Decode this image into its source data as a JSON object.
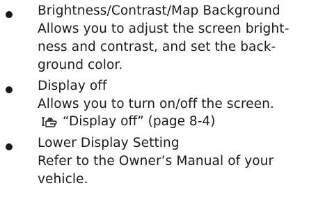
{
  "items": [
    {
      "title": "Brightness/Contrast/Map Background",
      "desc_lines": [
        "Allows you to adjust the screen bright-",
        "ness and contrast, and set the back-",
        "ground color."
      ]
    },
    {
      "title": "Display off",
      "desc_lines": [
        "Allows you to turn on/off the screen."
      ],
      "reference": {
        "icon": "reference-hand-icon",
        "text": "“Display off” (page 8-4)"
      }
    },
    {
      "title": "Lower Display Setting",
      "desc_lines": [
        "Refer to the Owner’s Manual of your",
        "vehicle."
      ]
    }
  ]
}
